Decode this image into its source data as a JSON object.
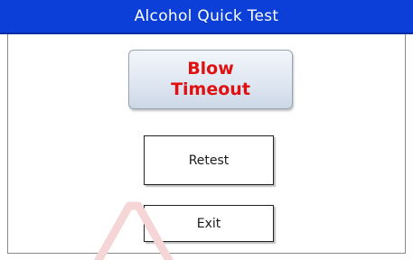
{
  "window": {
    "title": "Alcohol Quick Test"
  },
  "status": {
    "message": "Blow\nTimeout"
  },
  "buttons": {
    "retest_label": "Retest",
    "exit_label": "Exit"
  },
  "colors": {
    "title_bar": "#0b3fd8",
    "status_text": "#e01010",
    "watermark": "#f5d5d5"
  }
}
